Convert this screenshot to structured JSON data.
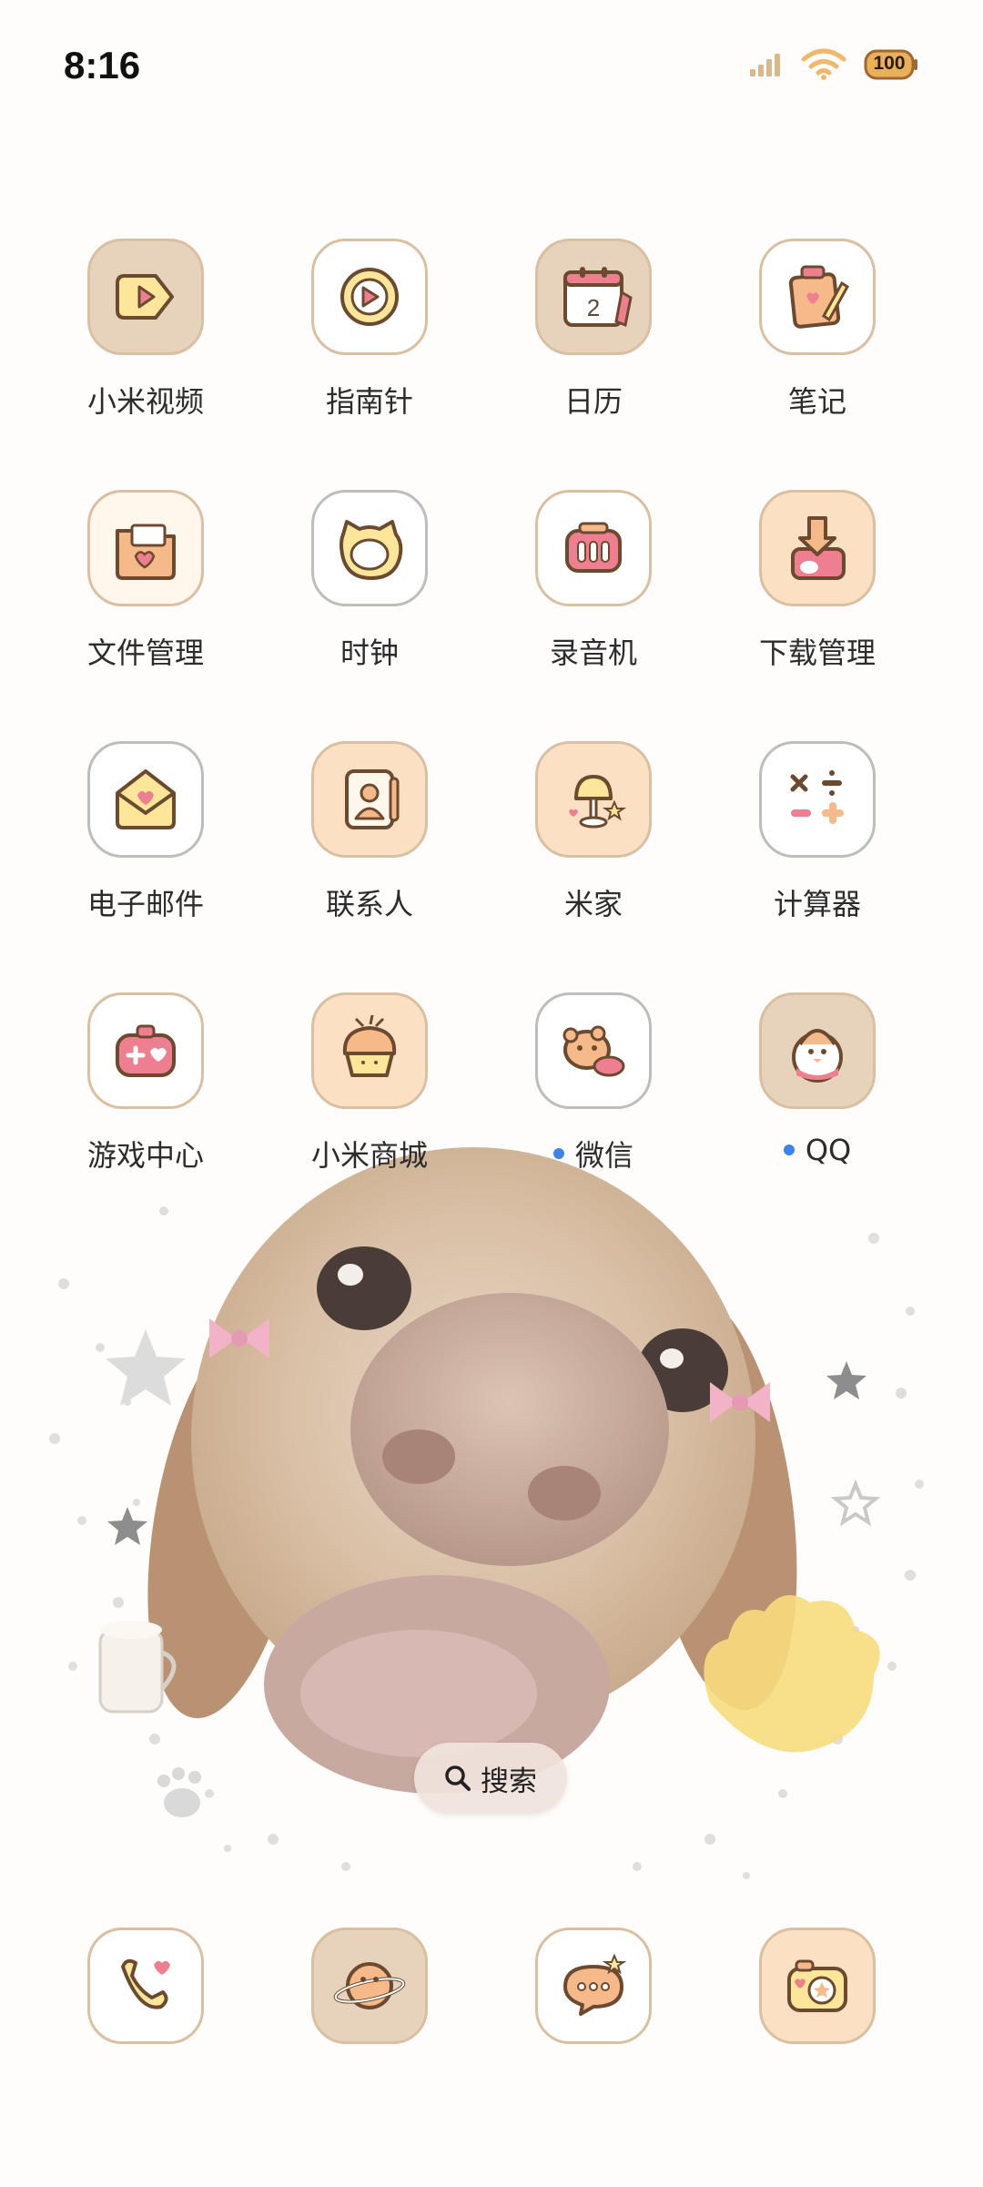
{
  "status_bar": {
    "time": "8:16",
    "battery": "100",
    "icons": [
      "signal-icon",
      "wifi-icon",
      "battery-icon"
    ]
  },
  "apps": [
    {
      "label": "小米视频",
      "icon": "video-play-icon"
    },
    {
      "label": "指南针",
      "icon": "compass-icon"
    },
    {
      "label": "日历",
      "icon": "calendar-icon",
      "calendar_day": "2"
    },
    {
      "label": "笔记",
      "icon": "notes-icon"
    },
    {
      "label": "文件管理",
      "icon": "folder-heart-icon"
    },
    {
      "label": "时钟",
      "icon": "cat-clock-icon"
    },
    {
      "label": "录音机",
      "icon": "recorder-icon"
    },
    {
      "label": "下载管理",
      "icon": "download-icon"
    },
    {
      "label": "电子邮件",
      "icon": "envelope-icon"
    },
    {
      "label": "联系人",
      "icon": "contacts-icon"
    },
    {
      "label": "米家",
      "icon": "lamp-icon"
    },
    {
      "label": "计算器",
      "icon": "calculator-icon"
    },
    {
      "label": "游戏中心",
      "icon": "game-controller-icon"
    },
    {
      "label": "小米商城",
      "icon": "cupcake-icon"
    },
    {
      "label": "微信",
      "icon": "wechat-bear-icon",
      "badge": true
    },
    {
      "label": "QQ",
      "icon": "penguin-icon",
      "badge": true
    }
  ],
  "search": {
    "label": "搜索",
    "icon": "search-icon"
  },
  "dock": [
    {
      "icon": "phone-icon"
    },
    {
      "icon": "planet-browser-icon"
    },
    {
      "icon": "message-bubble-icon"
    },
    {
      "icon": "camera-icon"
    }
  ],
  "colors": {
    "outline": "#6b4a30",
    "heart": "#ee7f90",
    "yellow": "#fde69a",
    "peach": "#f6b98a",
    "badge": "#3d84e8"
  }
}
